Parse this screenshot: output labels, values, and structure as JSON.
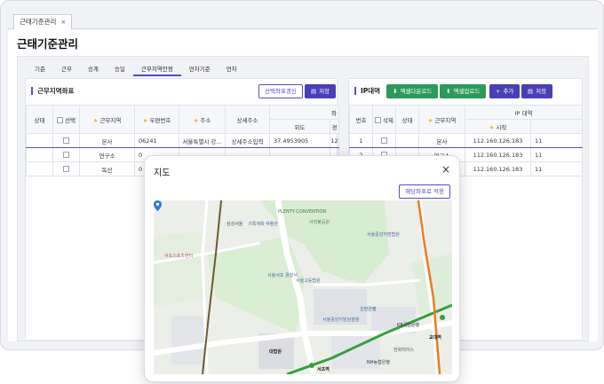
{
  "window_tab": {
    "label": "근태기준관리",
    "close": "×"
  },
  "page_title": "근태기준관리",
  "subtabs": [
    "기준",
    "근무",
    "승계",
    "승일",
    "근무지역안정",
    "연차기준",
    "연차"
  ],
  "left_panel": {
    "title": "근무지역좌표",
    "btn_update": "선택좌표갱신",
    "btn_save": "저장",
    "columns": [
      "상태",
      "선택",
      "근무지역",
      "우편번호",
      "주소",
      "상세주소",
      "위도",
      "경"
    ],
    "coord_group": "좌",
    "rows": [
      {
        "region": "본사",
        "zip": "06241",
        "addr": "서울특별시 강...",
        "detail": "상세주소입력",
        "lat": "37.4953905",
        "lng": "12"
      },
      {
        "region": "연구소",
        "zip": "0",
        "addr": "",
        "detail": "",
        "lat": "",
        "lng": ""
      },
      {
        "region": "독산",
        "zip": "0",
        "addr": "",
        "detail": "",
        "lat": "",
        "lng": ""
      }
    ]
  },
  "right_panel": {
    "title": "IP대역",
    "btn_excel_down": "엑셀다운로드",
    "btn_excel_up": "엑셀업로드",
    "btn_add": "추가",
    "btn_save": "저장",
    "columns": [
      "번호",
      "삭제",
      "상태",
      "근무지역",
      "시작",
      "IP 대역"
    ],
    "ip_group": "IP 대역",
    "rows": [
      {
        "no": "1",
        "region": "본사",
        "start": "112.160.126.183",
        "end": "11"
      },
      {
        "no": "2",
        "region": "연구소",
        "start": "112.160.126.183",
        "end": "11"
      },
      {
        "no": "3",
        "region": "독산",
        "start": "112.160.126.183",
        "end": "11"
      }
    ]
  },
  "modal": {
    "title": "지도",
    "close": "×",
    "apply_btn": "해당좌표로 적용",
    "map_labels": {
      "plenty": "PLENTY CONVENTION",
      "park": "서리풀공원",
      "samsung": "삼성서울",
      "museum": "기록계획\n박물관",
      "central_office": "서울서초\n경찰서",
      "high_court": "서울고등법원",
      "district_court": "서울중앙지방법원",
      "prosecutor": "서울중앙지방검찰청",
      "bank": "신한은행",
      "supreme": "대법원",
      "kb": "KB국민은행",
      "nh": "NH농협은행",
      "gyodae": "교대역",
      "seocho": "서초역",
      "court_station": "법원",
      "hanwha": "한화리어스",
      "sejong": "세종 빌딩",
      "sports": "서초스포츠센터"
    }
  },
  "colors": {
    "accent": "#5a4bc9",
    "green": "#2c9a5b",
    "line2": "#33a23d",
    "line3": "#ef7c1c"
  }
}
